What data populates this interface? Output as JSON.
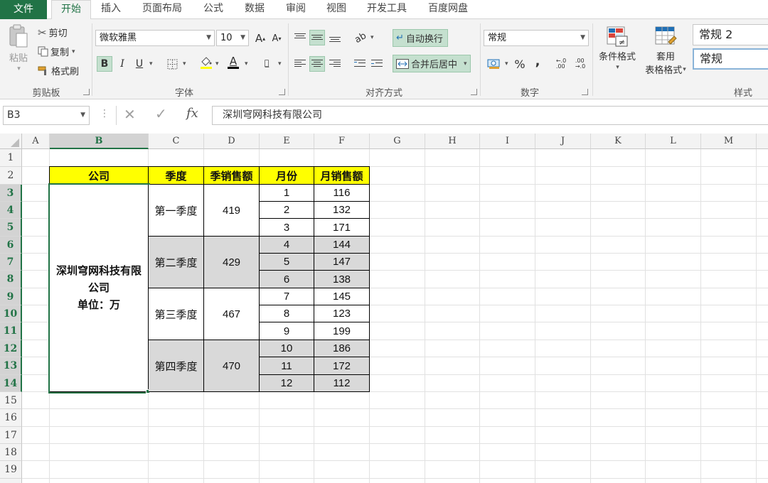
{
  "tabs": [
    {
      "label": "文件"
    },
    {
      "label": "开始"
    },
    {
      "label": "插入"
    },
    {
      "label": "页面布局"
    },
    {
      "label": "公式"
    },
    {
      "label": "数据"
    },
    {
      "label": "审阅"
    },
    {
      "label": "视图"
    },
    {
      "label": "开发工具"
    },
    {
      "label": "百度网盘"
    }
  ],
  "ribbon": {
    "clipboard": {
      "group": "剪贴板",
      "paste": "粘贴",
      "cut": "剪切",
      "copy": "复制",
      "format_painter": "格式刷"
    },
    "font": {
      "group": "字体",
      "font_name": "微软雅黑",
      "font_size": "10",
      "bold": "B",
      "italic": "I",
      "underline": "U",
      "grow": "A",
      "shrink": "A",
      "font_color": "A"
    },
    "alignment": {
      "group": "对齐方式",
      "wrap_text": "自动换行",
      "merge_center": "合并后居中"
    },
    "number": {
      "group": "数字",
      "format": "常规",
      "percent": "%",
      "comma": ","
    },
    "styles": {
      "group": "样式",
      "cond_format": "条件格式",
      "table_format_1": "套用",
      "table_format_2": "表格格式",
      "style1": "常规 2",
      "style2": "常规"
    }
  },
  "formula_bar": {
    "name_box": "B3",
    "fx": "fx",
    "content": "深圳穹网科技有限公司"
  },
  "columns": [
    "A",
    "B",
    "C",
    "D",
    "E",
    "F",
    "G",
    "H",
    "I",
    "J",
    "K",
    "L",
    "M"
  ],
  "rows": [
    "1",
    "2",
    "3",
    "4",
    "5",
    "6",
    "7",
    "8",
    "9",
    "10",
    "11",
    "12",
    "13",
    "14",
    "15",
    "16",
    "17",
    "18",
    "19"
  ],
  "table": {
    "headers": [
      "公司",
      "季度",
      "季销售额",
      "月份",
      "月销售额"
    ],
    "company_lines": [
      "深圳穹网科技有限",
      "公司",
      "单位：万"
    ],
    "quarters": [
      {
        "name": "第一季度",
        "total": "419",
        "months": [
          {
            "m": "1",
            "v": "116"
          },
          {
            "m": "2",
            "v": "132"
          },
          {
            "m": "3",
            "v": "171"
          }
        ]
      },
      {
        "name": "第二季度",
        "total": "429",
        "months": [
          {
            "m": "4",
            "v": "144"
          },
          {
            "m": "5",
            "v": "147"
          },
          {
            "m": "6",
            "v": "138"
          }
        ]
      },
      {
        "name": "第三季度",
        "total": "467",
        "months": [
          {
            "m": "7",
            "v": "145"
          },
          {
            "m": "8",
            "v": "123"
          },
          {
            "m": "9",
            "v": "199"
          }
        ]
      },
      {
        "name": "第四季度",
        "total": "470",
        "months": [
          {
            "m": "10",
            "v": "186"
          },
          {
            "m": "11",
            "v": "172"
          },
          {
            "m": "12",
            "v": "112"
          }
        ]
      }
    ]
  },
  "colors": {
    "accent": "#217346",
    "header_fill": "#ffff00",
    "gray_fill": "#d9d9d9"
  }
}
